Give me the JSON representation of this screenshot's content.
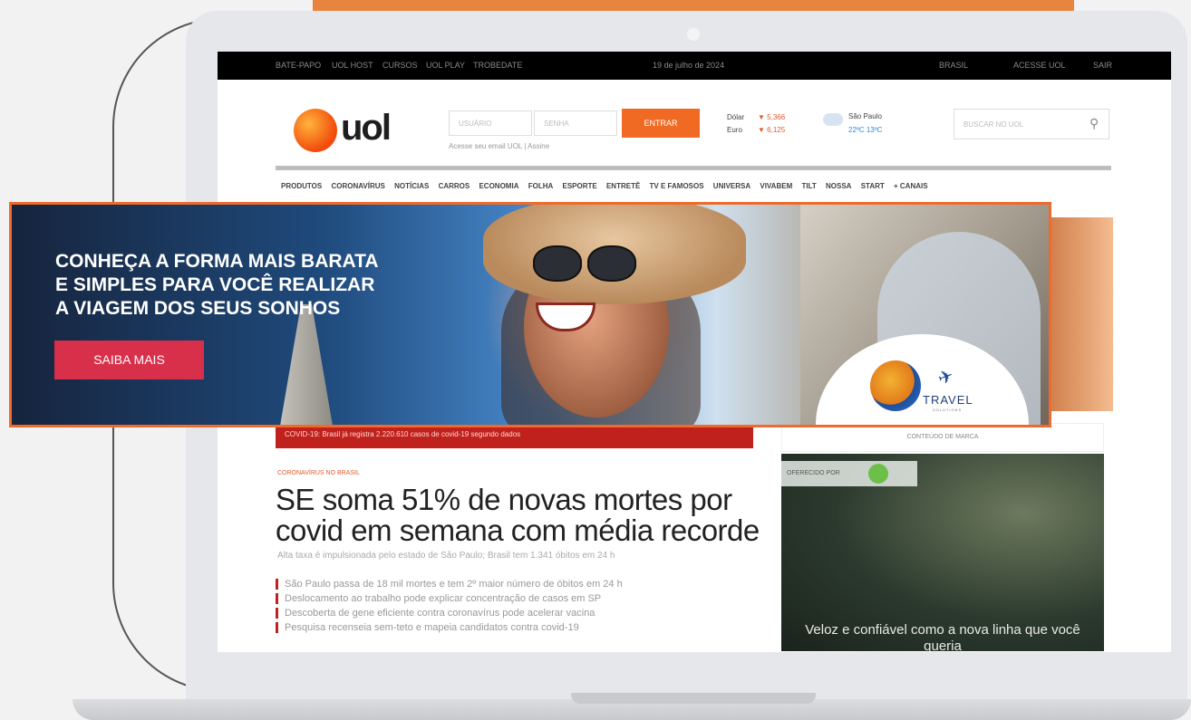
{
  "topbar": {
    "left_items": [
      "BATE-PAPO",
      "UOL HOST",
      "CURSOS",
      "UOL PLAY",
      "TROBEDATE"
    ],
    "date": "19 de julho de 2024",
    "right_items": [
      "BRASIL",
      "ACESSE UOL",
      "SAIR"
    ]
  },
  "site": {
    "logo_text": "uol",
    "login": {
      "user_placeholder": "USUÁRIO",
      "pass_placeholder": "SENHA",
      "enter_label": "ENTRAR",
      "hint": "Acesse seu email UOL | Assine"
    },
    "fx": [
      {
        "label": "Dólar",
        "value": "▼ 5,366"
      },
      {
        "label": "Euro",
        "value": "▼ 6,125"
      }
    ],
    "weather": {
      "city": "São Paulo",
      "temps": "22ºC  13ºC"
    },
    "search_placeholder": "BUSCAR NO UOL",
    "nav": [
      "PRODUTOS",
      "CORONAVÍRUS",
      "NOTÍCIAS",
      "CARROS",
      "ECONOMIA",
      "FOLHA",
      "ESPORTE",
      "ENTRETÊ",
      "TV E FAMOSOS",
      "UNIVERSA",
      "VIVABEM",
      "TILT",
      "NOSSA",
      "START",
      "+ CANAIS"
    ]
  },
  "news": {
    "alert": "COVID-19: Brasil já registra 2.220.610 casos de covid-19 segundo dados",
    "kicker": "CORONAVÍRUS NO BRASIL",
    "headline": "SE soma 51% de novas mortes por covid em semana com média recorde",
    "subhead": "Alta taxa é impulsionada pelo estado de São Paulo; Brasil tem 1.341 óbitos em 24 h",
    "bullets": [
      "São Paulo passa de 18 mil mortes e tem 2º maior número de óbitos em 24 h",
      "Deslocamento ao trabalho pode explicar concentração de casos em SP",
      "Descoberta de gene eficiente contra coronavírus pode acelerar vacina",
      "Pesquisa recenseia sem-teto e mapeia candidatos contra covid-19"
    ]
  },
  "aside": {
    "title": "CONTEÚDO DE MARCA",
    "tag": "OFERECIDO POR",
    "caption": "Veloz e confiável como a nova linha que você queria"
  },
  "banner": {
    "headline_lines": [
      "CONHEÇA A FORMA MAIS BARATA",
      "E SIMPLES PARA VOCÊ REALIZAR",
      "A VIAGEM DOS SEUS SONHOS"
    ],
    "cta": "SAIBA MAIS",
    "brand": "TRAVEL",
    "brand_sub": "SOLUTIONS",
    "border_color": "#ef6b2d",
    "cta_color": "#d8304a"
  }
}
